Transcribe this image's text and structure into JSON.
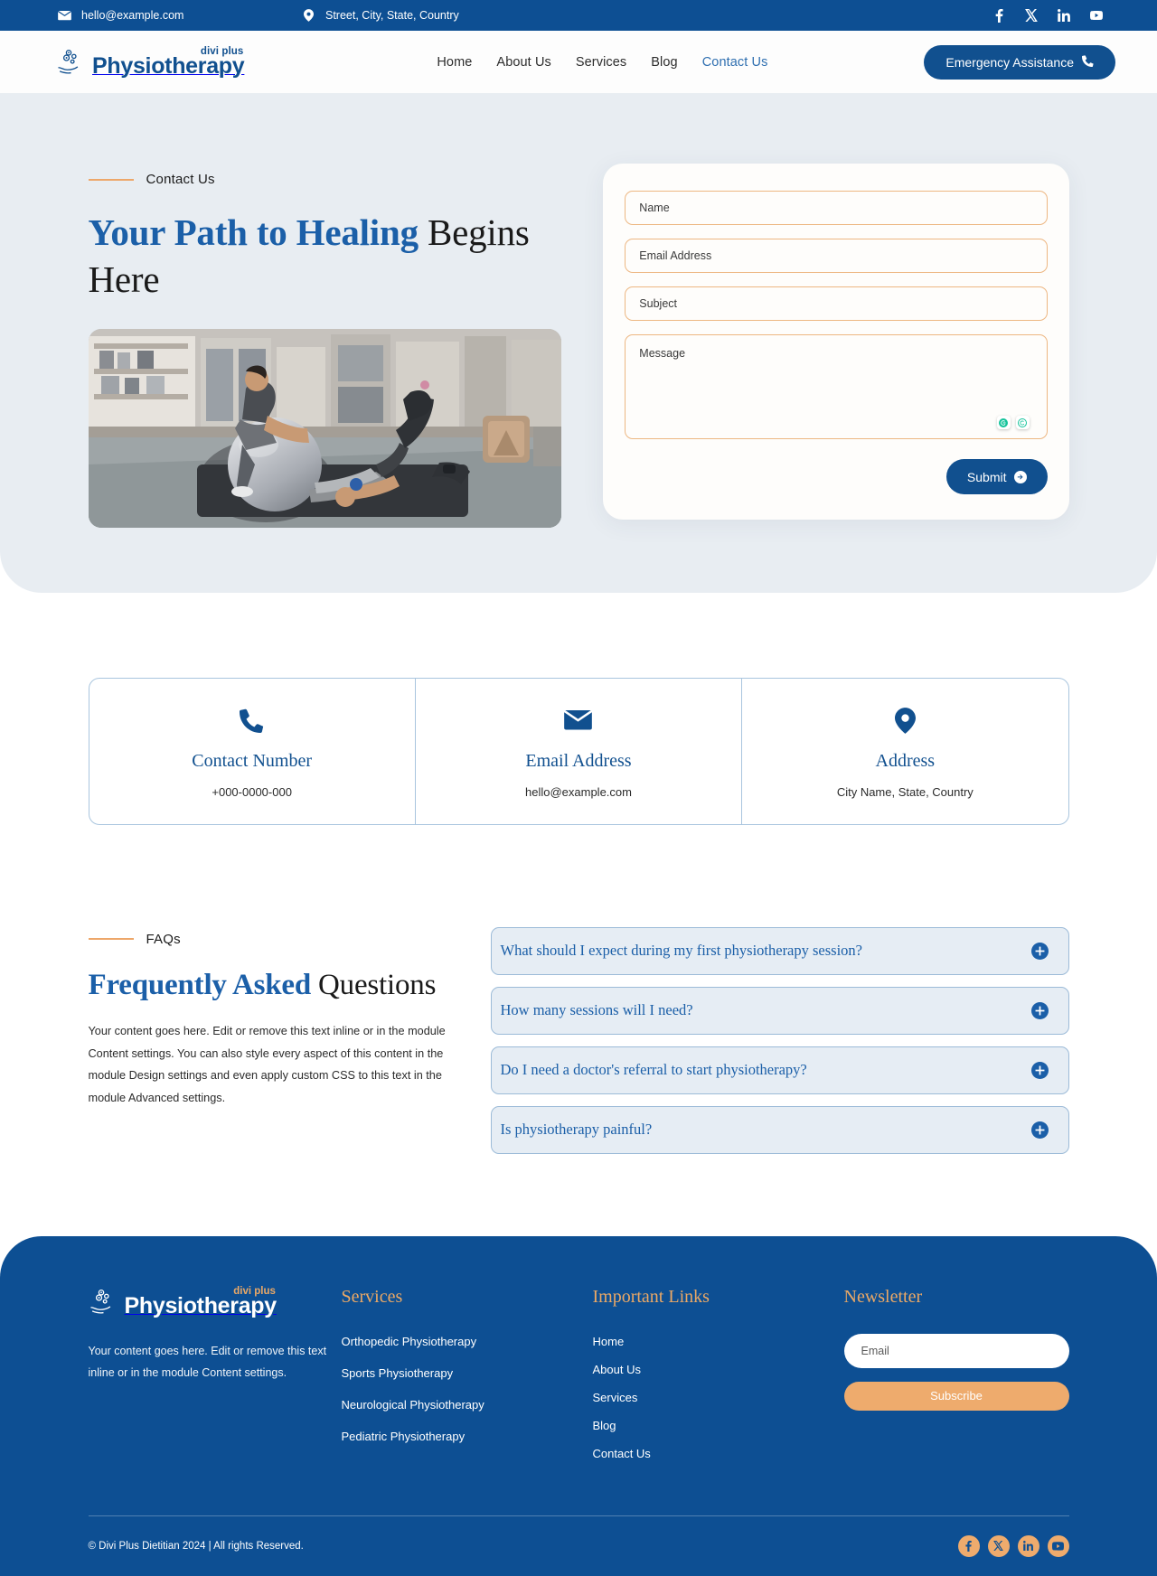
{
  "topbar": {
    "email": "hello@example.com",
    "email_icon": "envelope-icon",
    "address": "Street, City, State, Country",
    "address_icon": "location-pin-icon",
    "socials": [
      {
        "name": "facebook-icon",
        "label": "Facebook"
      },
      {
        "name": "x-twitter-icon",
        "label": "X"
      },
      {
        "name": "linkedin-icon",
        "label": "LinkedIn"
      },
      {
        "name": "youtube-icon",
        "label": "YouTube"
      }
    ]
  },
  "header": {
    "logo_sub": "divi plus",
    "logo_name": "Physiotherapy",
    "nav": [
      {
        "label": "Home",
        "active": false
      },
      {
        "label": "About Us",
        "active": false
      },
      {
        "label": "Services",
        "active": false
      },
      {
        "label": "Blog",
        "active": false
      },
      {
        "label": "Contact Us",
        "active": true
      }
    ],
    "cta_label": "Emergency Assistance",
    "cta_icon": "phone-icon"
  },
  "hero": {
    "eyebrow": "Contact Us",
    "title_highlight": "Your Path to Healing",
    "title_rest": " Begins Here",
    "image_alt": "physiotherapist-assisting-patient-with-exercise-ball"
  },
  "form": {
    "name_placeholder": "Name",
    "email_placeholder": "Email Address",
    "subject_placeholder": "Subject",
    "message_placeholder": "Message",
    "submit_label": "Submit",
    "badges": [
      "grammarly-icon",
      "grammarly-check-icon"
    ]
  },
  "contact_cards": [
    {
      "icon": "phone-icon",
      "title": "Contact Number",
      "value": "+000-0000-000"
    },
    {
      "icon": "envelope-icon",
      "title": "Email Address",
      "value": "hello@example.com"
    },
    {
      "icon": "location-pin-icon",
      "title": "Address",
      "value": "City Name, State, Country"
    }
  ],
  "faq": {
    "eyebrow": "FAQs",
    "title_highlight": "Frequently Asked",
    "title_rest": " Questions",
    "body": "Your content goes here. Edit or remove this text inline or in the module Content settings. You can also style every aspect of this content in the module Design settings and even apply custom CSS to this text in the module Advanced settings.",
    "items": [
      {
        "question": "What should I expect during my first physiotherapy session?",
        "icon": "plus-circle-icon"
      },
      {
        "question": "How many sessions will I need?",
        "icon": "plus-circle-icon"
      },
      {
        "question": "Do I need a doctor's referral to start physiotherapy?",
        "icon": "plus-circle-icon"
      },
      {
        "question": "Is physiotherapy painful?",
        "icon": "plus-circle-icon"
      }
    ]
  },
  "footer": {
    "logo_sub": "divi plus",
    "logo_name": "Physiotherapy",
    "about": "Your content goes here. Edit or remove this text inline or in the module Content settings.",
    "services_head": "Services",
    "services": [
      "Orthopedic Physiotherapy",
      "Sports Physiotherapy",
      "Neurological Physiotherapy",
      "Pediatric Physiotherapy"
    ],
    "links_head": "Important Links",
    "links": [
      "Home",
      "About Us",
      "Services",
      "Blog",
      "Contact Us"
    ],
    "newsletter_head": "Newsletter",
    "email_placeholder": "Email",
    "subscribe_label": "Subscribe",
    "copyright": "© Divi Plus Dietitian 2024 | All rights Reserved.",
    "socials": [
      {
        "name": "facebook-icon",
        "label": "Facebook"
      },
      {
        "name": "x-twitter-icon",
        "label": "X"
      },
      {
        "name": "linkedin-icon",
        "label": "LinkedIn"
      },
      {
        "name": "youtube-icon",
        "label": "YouTube"
      }
    ]
  },
  "colors": {
    "brand_blue": "#0d4f93",
    "accent_orange": "#eeab6d",
    "hero_bg": "#e8edf2",
    "link_blue": "#1b5fa8"
  }
}
